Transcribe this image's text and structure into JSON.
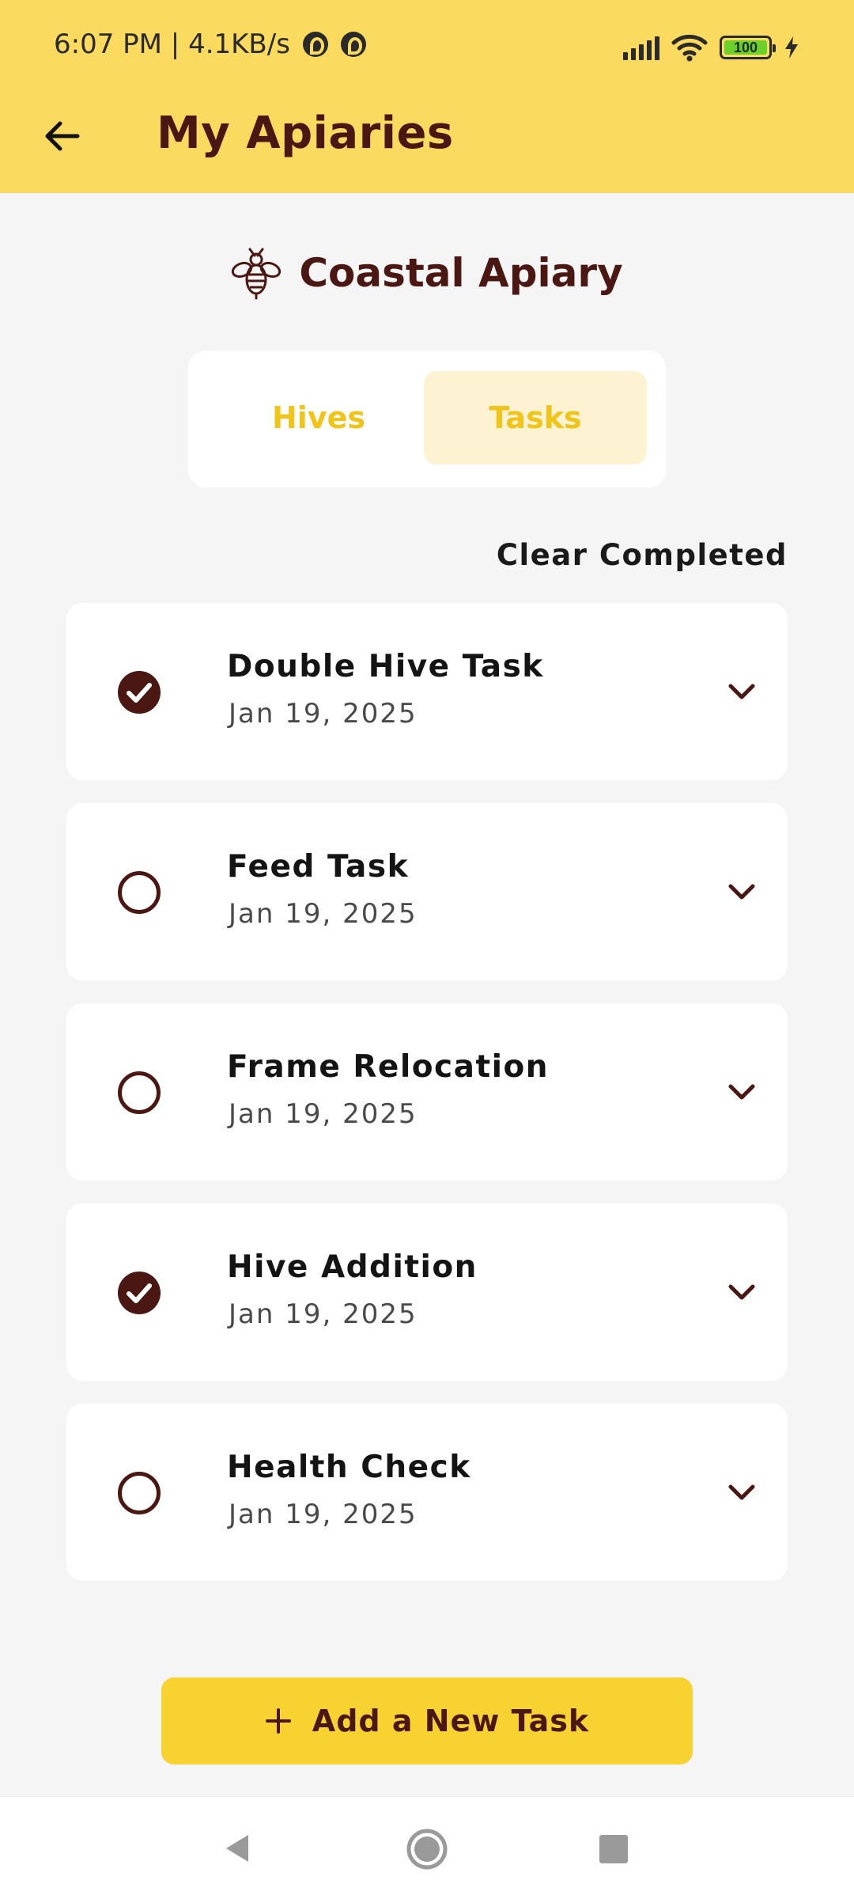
{
  "status_bar": {
    "time_speed": "6:07 PM | 4.1KB/s",
    "battery_level": "100",
    "icons": [
      "notification-badge-icon",
      "notification-badge-icon",
      "signal-icon",
      "wifi-icon",
      "battery-icon",
      "charging-icon"
    ]
  },
  "app_bar": {
    "title": "My Apiaries",
    "back_icon": "arrow-left-icon"
  },
  "apiary": {
    "name": "Coastal Apiary",
    "icon": "bee-icon"
  },
  "tabs": [
    {
      "label": "Hives",
      "selected": false
    },
    {
      "label": "Tasks",
      "selected": true
    }
  ],
  "actions": {
    "clear_completed": "Clear Completed",
    "add_task": "Add a New Task"
  },
  "tasks": [
    {
      "name": "Double Hive Task",
      "date": "Jan 19, 2025",
      "completed": true
    },
    {
      "name": "Feed Task",
      "date": "Jan 19, 2025",
      "completed": false
    },
    {
      "name": "Frame Relocation",
      "date": "Jan 19, 2025",
      "completed": false
    },
    {
      "name": "Hive Addition",
      "date": "Jan 19, 2025",
      "completed": true
    },
    {
      "name": "Health Check",
      "date": "Jan 19, 2025",
      "completed": false
    }
  ],
  "colors": {
    "header_bg": "#fadb60",
    "brand_dark": "#4a1712",
    "tab_text": "#f0c419",
    "tab_selected_bg": "#fdf3d3",
    "button_bg": "#f8d230",
    "page_bg": "#f5f5f5"
  }
}
